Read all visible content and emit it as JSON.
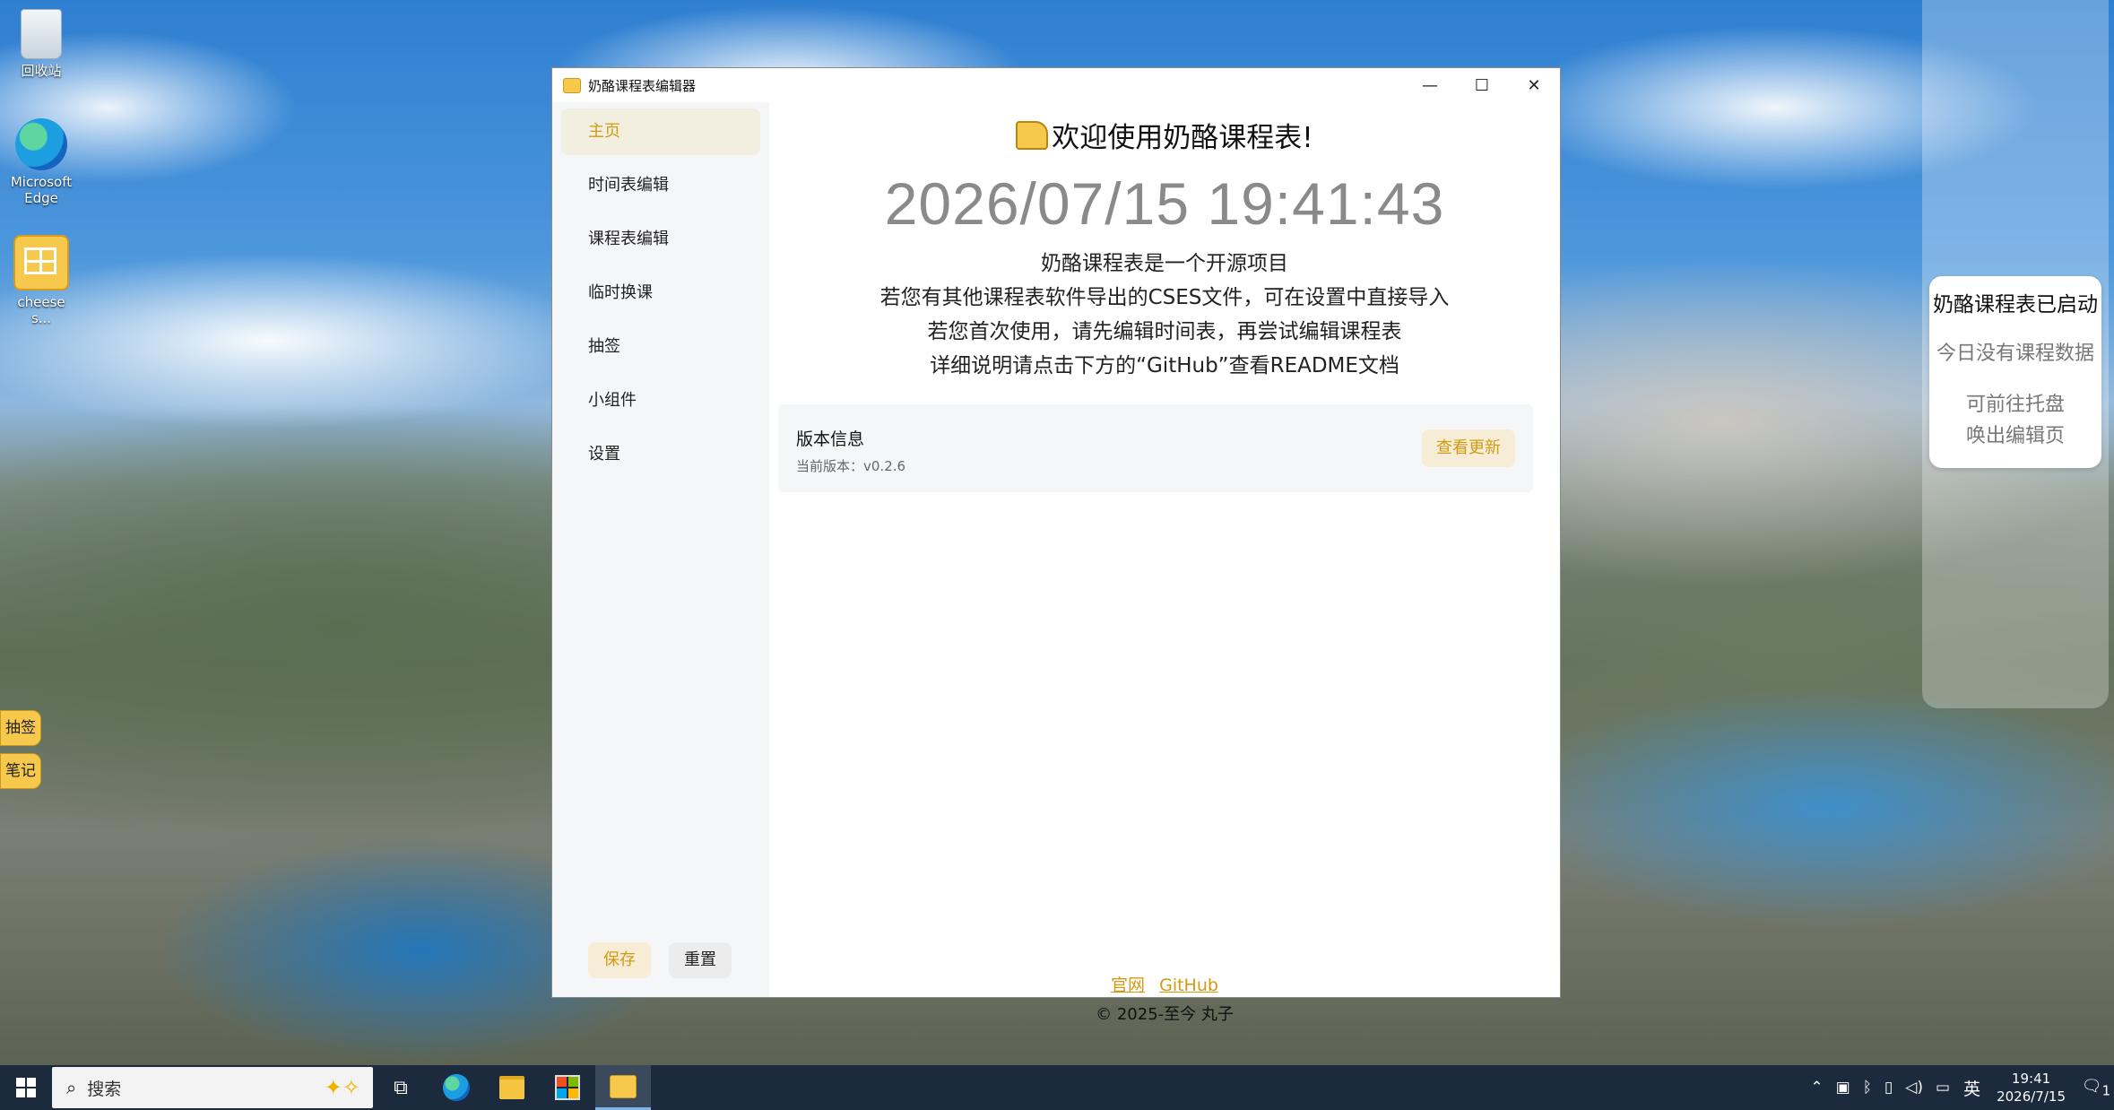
{
  "desktop": {
    "icons": [
      {
        "label": "回收站"
      },
      {
        "label": "Microsoft Edge"
      },
      {
        "label": "cheese s..."
      }
    ],
    "side_pills": [
      "抽签",
      "笔记"
    ]
  },
  "notification": {
    "title": "奶酪课程表已启动",
    "line1": "今日没有课程数据",
    "line2": "可前往托盘",
    "line3": "唤出编辑页"
  },
  "window": {
    "title": "奶酪课程表编辑器",
    "controls": {
      "minimize": "—",
      "maximize": "☐",
      "close": "✕"
    }
  },
  "sidebar": {
    "items": [
      {
        "label": "主页",
        "active": true
      },
      {
        "label": "时间表编辑"
      },
      {
        "label": "课程表编辑"
      },
      {
        "label": "临时换课"
      },
      {
        "label": "抽签"
      },
      {
        "label": "小组件"
      },
      {
        "label": "设置"
      }
    ],
    "save_label": "保存",
    "reset_label": "重置"
  },
  "main": {
    "welcome": "欢迎使用奶酪课程表!",
    "datetime": "2026/07/15 19:41:43",
    "intro": [
      "奶酪课程表是一个开源项目",
      "若您有其他课程表软件导出的CSES文件，可在设置中直接导入",
      "若您首次使用，请先编辑时间表，再尝试编辑课程表",
      "详细说明请点击下方的“GitHub”查看README文档"
    ],
    "version_card": {
      "title": "版本信息",
      "subtitle": "当前版本：v0.2.6",
      "update_label": "查看更新"
    },
    "footer": {
      "link_site": "官网",
      "link_github": "GitHub",
      "copyright": "© 2025-至今 丸子"
    }
  },
  "taskbar": {
    "search_placeholder": "搜索",
    "ime": "英",
    "time": "19:41",
    "date": "2026/7/15",
    "notification_count": "1"
  },
  "colors": {
    "accent": "#d19a12",
    "accent_bg": "#f7edd6",
    "sidebar_bg": "#f5f6f8",
    "taskbar_bg": "#1b2a3c"
  }
}
